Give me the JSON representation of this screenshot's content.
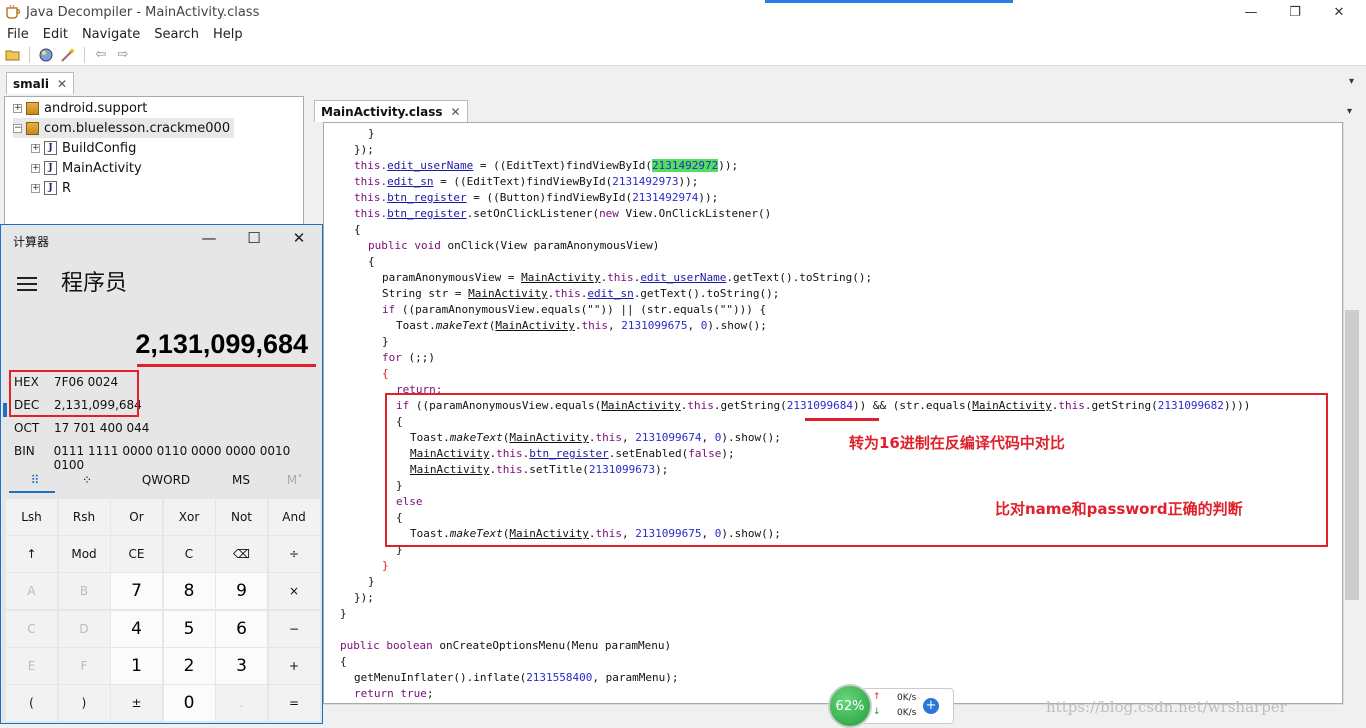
{
  "window": {
    "title": "Java Decompiler - MainActivity.class",
    "minimize": "—",
    "maximize": "❐",
    "close": "✕"
  },
  "menu": [
    "File",
    "Edit",
    "Navigate",
    "Search",
    "Help"
  ],
  "left_tab": {
    "label": "smali"
  },
  "tree": {
    "items": [
      {
        "label": "android.support"
      },
      {
        "label": "com.bluelesson.crackme000"
      },
      {
        "label": "BuildConfig"
      },
      {
        "label": "MainActivity"
      },
      {
        "label": "R"
      }
    ]
  },
  "editor_tab": {
    "label": "MainActivity.class"
  },
  "code": {
    "l1": "}",
    "l2": "});",
    "l3a": "this.",
    "l3b": "edit_userName",
    "l3c": " = ((EditText)findViewById(",
    "l3d": "2131492972",
    "l3e": "));",
    "l4b": "edit_sn",
    "l4c": " = ((EditText)findViewById(",
    "l4d": "2131492973",
    "l4e": "));",
    "l5b": "btn_register",
    "l5c": " = ((Button)findViewById(",
    "l5d": "2131492974",
    "l5e": "));",
    "l6c": ".setOnClickListener(",
    "l6d": "new",
    "l6e": " View.OnClickListener()",
    "l7": "{",
    "l8a": "public void",
    "l8b": " onClick(View paramAnonymousView)",
    "l9": "{",
    "l10a": "paramAnonymousView = ",
    "l10b": "MainActivity",
    "l10c": ".",
    "l10d": "this",
    "l10e": ".",
    "l10f": "edit_userName",
    "l10g": ".getText().toString();",
    "l11a": "String str = ",
    "l11f": "edit_sn",
    "l11g": ".getText().toString();",
    "l12a": "if",
    "l12b": " ((paramAnonymousView.equals(\"\")) || (str.equals(\"\"))) {",
    "l13a": "Toast.",
    "l13b": "makeText",
    "l13c": "(",
    "l13e": ", ",
    "l13f": "2131099675",
    "l13g": ", ",
    "l13h": "0",
    "l13i": ").show();",
    "l14": "}",
    "l15a": "for",
    "l15b": " (;;)",
    "l16": "{",
    "l17": "return;",
    "l18b": " ((paramAnonymousView.equals(",
    "l18c": ".getString(",
    "l18d": "2131099684",
    "l18e": ")) && (str.equals(",
    "l18f": "2131099682",
    "l18g": "))))",
    "l19": "{",
    "l20f": "2131099674",
    "l21b": ".setEnabled(",
    "l21c": "false",
    "l21d": ");",
    "l22b": ".setTitle(",
    "l22c": "2131099673",
    "l22d": ");",
    "l23": "}",
    "l24": "else",
    "l25": "{",
    "l26f": "2131099675",
    "l27": "}",
    "l28": "}",
    "l29": "}",
    "l30": "});",
    "l31": "}",
    "l32a": "public boolean",
    "l32b": " onCreateOptionsMenu(Menu paramMenu)",
    "l33": "{",
    "l34a": "getMenuInflater().inflate(",
    "l34b": "2131558400",
    "l34c": ", paramMenu);",
    "l35a": "return",
    "l35b": " true",
    "l35c": ";"
  },
  "annotations": {
    "hex_compare": "转为16进制在反编译代码中对比",
    "name_password": "比对name和password正确的判断"
  },
  "calculator": {
    "title": "计算器",
    "mode": "程序员",
    "display": "2,131,099,684",
    "radix": [
      {
        "label": "HEX",
        "value": "7F06 0024"
      },
      {
        "label": "DEC",
        "value": "2,131,099,684"
      },
      {
        "label": "OCT",
        "value": "17 701 400 044"
      },
      {
        "label": "BIN",
        "value": "0111 1111 0000 0110 0000 0000 0010 0100"
      }
    ],
    "tabs": [
      "QWORD",
      "MS",
      "M˅"
    ],
    "keys": [
      [
        "Lsh",
        "Rsh",
        "Or",
        "Xor",
        "Not",
        "And"
      ],
      [
        "↑",
        "Mod",
        "CE",
        "C",
        "⌫",
        "÷"
      ],
      [
        "A",
        "B",
        "7",
        "8",
        "9",
        "×"
      ],
      [
        "C",
        "D",
        "4",
        "5",
        "6",
        "−"
      ],
      [
        "E",
        "F",
        "1",
        "2",
        "3",
        "+"
      ],
      [
        "(",
        ")",
        "±",
        "0",
        ".",
        "="
      ]
    ]
  },
  "network": {
    "percent": "62%",
    "up": "0K/s",
    "down": "0K/s"
  },
  "watermark": "https://blog.csdn.net/wrsharper"
}
